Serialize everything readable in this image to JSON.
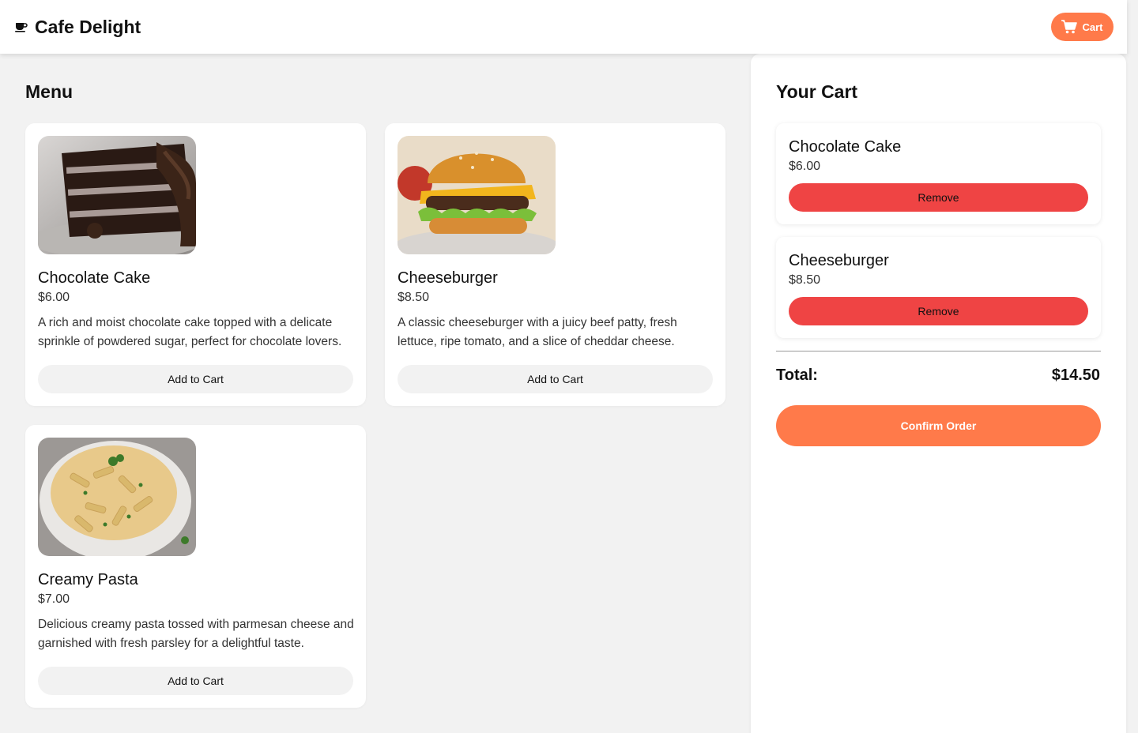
{
  "header": {
    "brand_icon": "coffee-cup-icon",
    "title": "Cafe Delight",
    "cart_button_label": "Cart",
    "cart_icon": "shopping-cart-icon"
  },
  "colors": {
    "accent": "#ff7a4a",
    "remove": "#ef4444",
    "background": "#f2f2f2",
    "card": "#ffffff"
  },
  "menu": {
    "title": "Menu",
    "items": [
      {
        "name": "Chocolate Cake",
        "price": "$6.00",
        "description": "A rich and moist chocolate cake topped with a delicate sprinkle of powdered sugar, perfect for chocolate lovers.",
        "button_label": "Add to Cart",
        "image": "chocolate-cake-photo"
      },
      {
        "name": "Cheeseburger",
        "price": "$8.50",
        "description": "A classic cheeseburger with a juicy beef patty, fresh lettuce, ripe tomato, and a slice of cheddar cheese.",
        "button_label": "Add to Cart",
        "image": "cheeseburger-photo"
      },
      {
        "name": "Creamy Pasta",
        "price": "$7.00",
        "description": "Delicious creamy pasta tossed with parmesan cheese and garnished with fresh parsley for a delightful taste.",
        "button_label": "Add to Cart",
        "image": "creamy-pasta-photo"
      }
    ]
  },
  "cart": {
    "title": "Your Cart",
    "items": [
      {
        "name": "Chocolate Cake",
        "price": "$6.00",
        "remove_label": "Remove"
      },
      {
        "name": "Cheeseburger",
        "price": "$8.50",
        "remove_label": "Remove"
      }
    ],
    "total_label": "Total:",
    "total_value": "$14.50",
    "confirm_label": "Confirm Order"
  }
}
